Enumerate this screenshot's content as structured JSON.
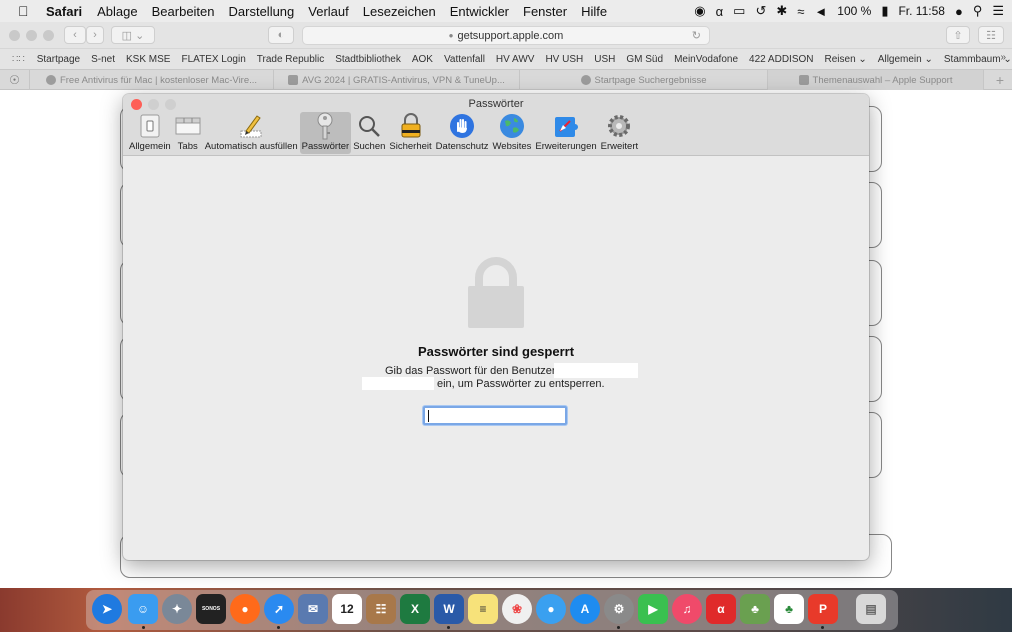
{
  "menubar": {
    "app": "Safari",
    "items": [
      "Ablage",
      "Bearbeiten",
      "Darstellung",
      "Verlauf",
      "Lesezeichen",
      "Entwickler",
      "Fenster",
      "Hilfe"
    ],
    "battery": "100 %",
    "clock": "Fr. 11:58"
  },
  "toolbar": {
    "url": "getsupport.apple.com"
  },
  "favorites": [
    "Startpage",
    "S-net",
    "KSK MSE",
    "FLATEX Login",
    "Trade Republic",
    "Stadtbibliothek",
    "AOK",
    "Vattenfall",
    "HV AWV",
    "HV USH",
    "USH",
    "GM Süd",
    "MeinVodafone",
    "422 ADDISON",
    "Reisen ⌄",
    "Allgemein ⌄",
    "Stammbaum ⌄"
  ],
  "tabs": [
    {
      "title": "Free Antivirus für Mac | kostenloser Mac-Vire..."
    },
    {
      "title": "AVG 2024 | GRATIS-Antivirus, VPN & TuneUp..."
    },
    {
      "title": "Startpage Suchergebnisse"
    },
    {
      "title": "Themenauswahl – Apple Support"
    }
  ],
  "prefs": {
    "title": "Passwörter",
    "tabs": [
      {
        "label": "Allgemein",
        "icon": "general-switch-icon"
      },
      {
        "label": "Tabs",
        "icon": "tabs-icon"
      },
      {
        "label": "Automatisch ausfüllen",
        "icon": "pencil-icon"
      },
      {
        "label": "Passwörter",
        "icon": "key-icon",
        "active": true
      },
      {
        "label": "Suchen",
        "icon": "magnifier-icon"
      },
      {
        "label": "Sicherheit",
        "icon": "padlock-warning-icon"
      },
      {
        "label": "Datenschutz",
        "icon": "hand-icon"
      },
      {
        "label": "Websites",
        "icon": "globe-icon"
      },
      {
        "label": "Erweiterungen",
        "icon": "puzzle-icon"
      },
      {
        "label": "Erweitert",
        "icon": "gear-icon"
      }
    ],
    "locked_title": "Passwörter sind gesperrt",
    "locked_line1": "Gib das Passwort für den Benutzer",
    "locked_line2": "ein, um Passwörter zu entsperren.",
    "password_value": ""
  },
  "colors": {
    "close": "#fe5f57",
    "minimize": "#c8c8c8",
    "zoom": "#c8c8c8",
    "focus_ring": "#7aa7e6",
    "lock_gray": "#d4d4d4"
  },
  "dock": {
    "apps": [
      "safari-icon",
      "finder-icon",
      "launchpad-icon",
      "sonos-icon",
      "firefox-icon",
      "safari-compass-icon",
      "mail-icon",
      "calendar-icon",
      "contacts-icon",
      "excel-icon",
      "word-icon",
      "notes-icon",
      "photos-icon",
      "messages-icon",
      "app-store-icon",
      "system-preferences-icon",
      "facetime-icon",
      "music-icon",
      "acrobat-icon",
      "family-tree-icon",
      "macfamilytree-icon",
      "pdf-expert-icon",
      "trash-icon"
    ],
    "calendar_day": "12",
    "sonos_label": "SONOS"
  }
}
